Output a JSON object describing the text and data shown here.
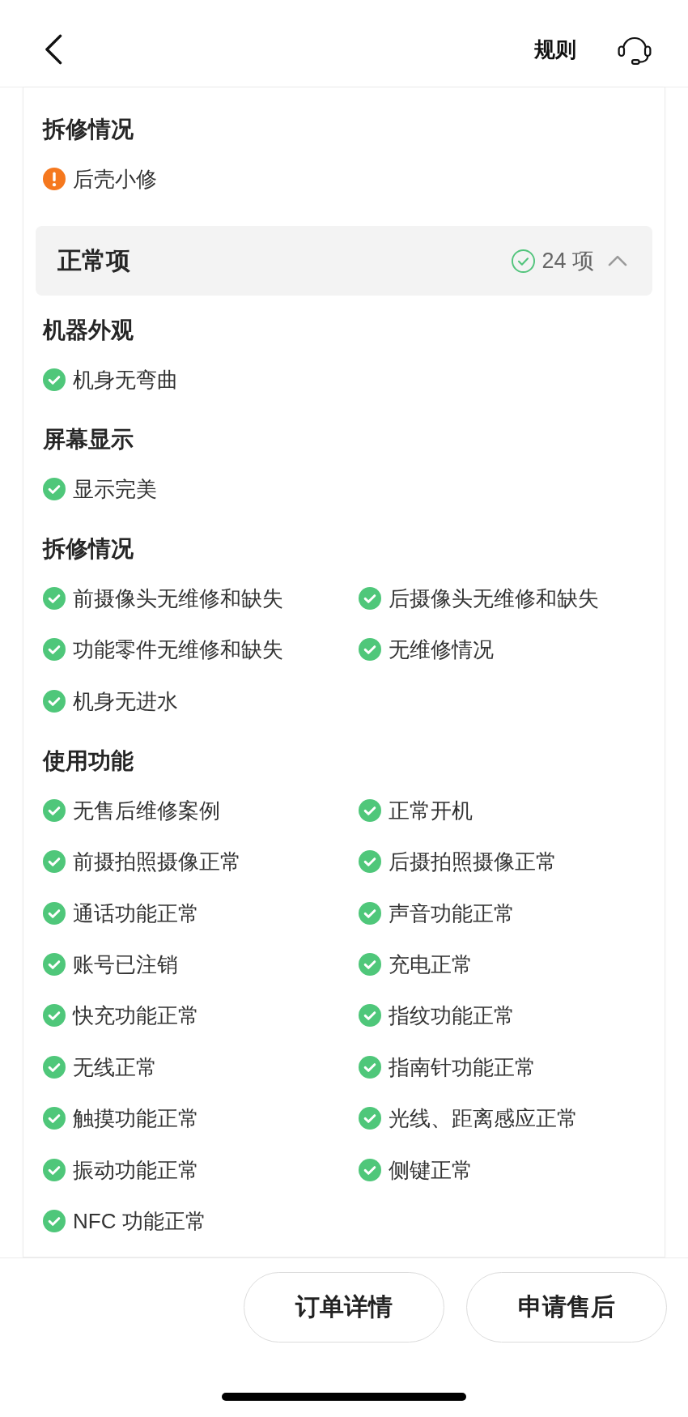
{
  "nav": {
    "rules_link": "规则"
  },
  "repair_status": {
    "title": "拆修情况",
    "items": [
      {
        "kind": "warning",
        "text": "后壳小修"
      }
    ]
  },
  "normal_items": {
    "title": "正常项",
    "count": "24 项",
    "expanded": true,
    "groups": [
      {
        "title": "机器外观",
        "items": [
          {
            "kind": "ok",
            "text": "机身无弯曲"
          }
        ]
      },
      {
        "title": "屏幕显示",
        "items": [
          {
            "kind": "ok",
            "text": "显示完美"
          }
        ]
      },
      {
        "title": "拆修情况",
        "items": [
          {
            "kind": "ok",
            "text": "前摄像头无维修和缺失"
          },
          {
            "kind": "ok",
            "text": "后摄像头无维修和缺失"
          },
          {
            "kind": "ok",
            "text": "功能零件无维修和缺失"
          },
          {
            "kind": "ok",
            "text": "无维修情况"
          },
          {
            "kind": "ok",
            "text": "机身无进水"
          }
        ]
      },
      {
        "title": "使用功能",
        "items": [
          {
            "kind": "ok",
            "text": "无售后维修案例"
          },
          {
            "kind": "ok",
            "text": "正常开机"
          },
          {
            "kind": "ok",
            "text": "前摄拍照摄像正常"
          },
          {
            "kind": "ok",
            "text": "后摄拍照摄像正常"
          },
          {
            "kind": "ok",
            "text": "通话功能正常"
          },
          {
            "kind": "ok",
            "text": "声音功能正常"
          },
          {
            "kind": "ok",
            "text": "账号已注销"
          },
          {
            "kind": "ok",
            "text": "充电正常"
          },
          {
            "kind": "ok",
            "text": "快充功能正常"
          },
          {
            "kind": "ok",
            "text": "指纹功能正常"
          },
          {
            "kind": "ok",
            "text": "无线正常"
          },
          {
            "kind": "ok",
            "text": "指南针功能正常"
          },
          {
            "kind": "ok",
            "text": "触摸功能正常"
          },
          {
            "kind": "ok",
            "text": "光线、距离感应正常"
          },
          {
            "kind": "ok",
            "text": "振动功能正常"
          },
          {
            "kind": "ok",
            "text": "侧键正常"
          },
          {
            "kind": "ok",
            "text": "NFC 功能正常"
          }
        ]
      }
    ]
  },
  "buttons": [
    {
      "label": "订单详情"
    },
    {
      "label": "申请售后"
    }
  ]
}
